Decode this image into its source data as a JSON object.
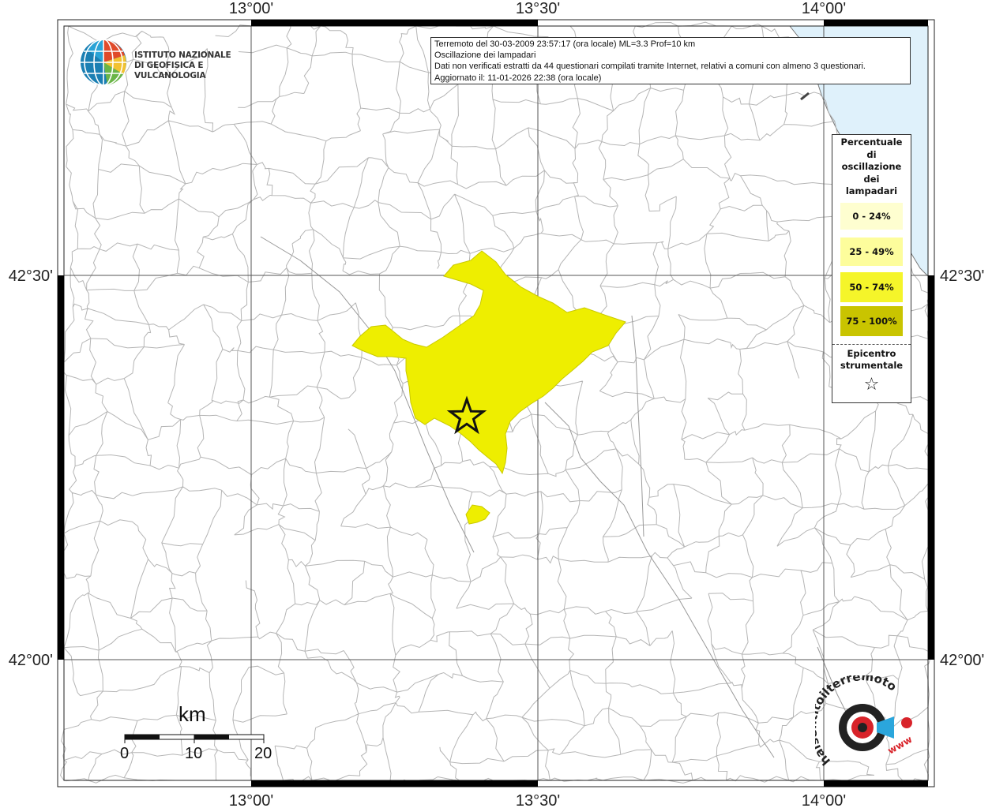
{
  "map": {
    "lon_ticks_top": [
      "13°00'",
      "13°30'",
      "14°00'"
    ],
    "lon_ticks_bottom": [
      "13°00'",
      "13°30'",
      "14°00'"
    ],
    "lat_ticks_left": [
      "42°30'",
      "42°00'"
    ],
    "lat_ticks_right": [
      "42°30'",
      "42°00'"
    ],
    "colors": {
      "sea": "#dff1fb",
      "land": "#ffffff",
      "border": "#b5b5b5",
      "fill_50_74": "#eeee00"
    }
  },
  "logo": {
    "line1": "ISTITUTO NAZIONALE",
    "line2": "DI GEOFISICA E VULCANOLOGIA"
  },
  "info": {
    "line1": "Terremoto del 30-03-2009 23:57:17 (ora locale) ML=3.3 Prof=10 km",
    "line2": "Oscillazione dei lampadari",
    "line3": "Dati non verificati estratti da 44 questionari compilati tramite Internet, relativi a comuni con almeno 3 questionari.",
    "line4": "Aggiornato il: 11-01-2026 22:38 (ora locale)"
  },
  "legend": {
    "title_lines": [
      "Percentuale",
      "di",
      "oscillazione",
      "dei",
      "lampadari"
    ],
    "classes": [
      {
        "label": "0 - 24%",
        "color": "#fefed0"
      },
      {
        "label": "25 - 49%",
        "color": "#fdfd9c"
      },
      {
        "label": "50 - 74%",
        "color": "#f5f52a"
      },
      {
        "label": "75 - 100%",
        "color": "#c9c400"
      }
    ],
    "epicenter_lines": [
      "Epicentro",
      "strumentale"
    ],
    "epicenter_symbol": "☆"
  },
  "scale": {
    "unit": "km",
    "labels": [
      "0",
      "10",
      "20"
    ]
  },
  "hsn_logo": {
    "text": "haisentitoilterremoto.it",
    "www": "www"
  }
}
